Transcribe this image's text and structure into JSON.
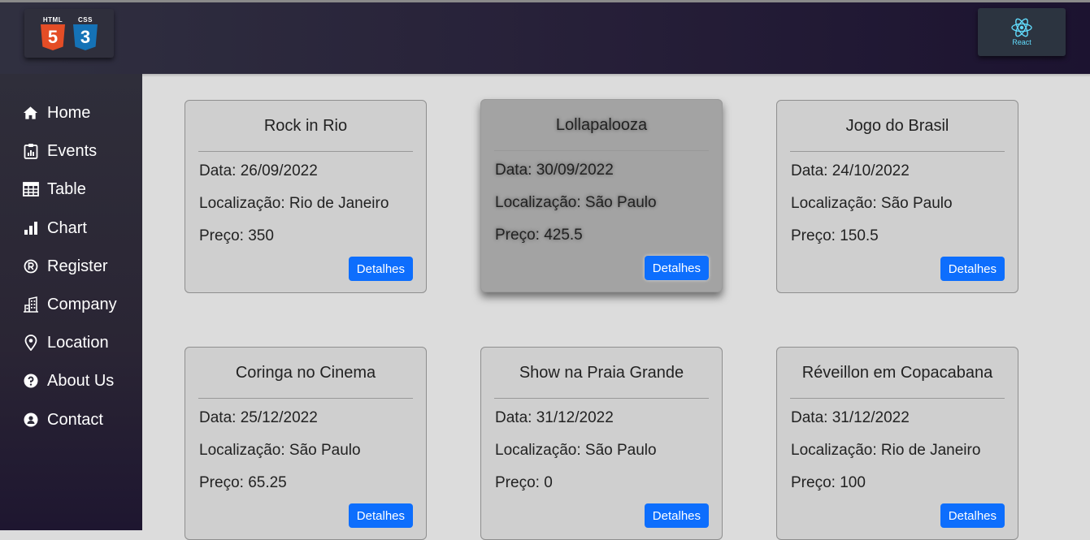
{
  "header": {
    "logo_left": {
      "html_label": "HTML",
      "html_char": "5",
      "css_label": "CSS",
      "css_char": "3"
    },
    "logo_right": {
      "label": "React",
      "icon": "react-atom-icon"
    }
  },
  "sidebar": {
    "items": [
      {
        "label": "Home",
        "icon": "home-icon"
      },
      {
        "label": "Events",
        "icon": "clipboard-icon"
      },
      {
        "label": "Table",
        "icon": "table-icon"
      },
      {
        "label": "Chart",
        "icon": "bar-chart-icon"
      },
      {
        "label": "Register",
        "icon": "registered-icon"
      },
      {
        "label": "Company",
        "icon": "building-icon"
      },
      {
        "label": "Location",
        "icon": "map-pin-icon"
      },
      {
        "label": "About Us",
        "icon": "question-icon"
      },
      {
        "label": "Contact",
        "icon": "contact-icon"
      }
    ]
  },
  "events": [
    {
      "title": "Rock in Rio",
      "date": "Data: 26/09/2022",
      "location": "Localização: Rio de Janeiro",
      "price": "Preço: 350",
      "button": "Detalhes"
    },
    {
      "title": "Lollapalooza",
      "date": "Data: 30/09/2022",
      "location": "Localização: São Paulo",
      "price": "Preço: 425.5",
      "button": "Detalhes"
    },
    {
      "title": "Jogo do Brasil",
      "date": "Data: 24/10/2022",
      "location": "Localização: São Paulo",
      "price": "Preço: 150.5",
      "button": "Detalhes"
    },
    {
      "title": "Coringa no Cinema",
      "date": "Data: 25/12/2022",
      "location": "Localização: São Paulo",
      "price": "Preço: 65.25",
      "button": "Detalhes"
    },
    {
      "title": "Show na Praia Grande",
      "date": "Data: 31/12/2022",
      "location": "Localização: São Paulo",
      "price": "Preço: 0",
      "button": "Detalhes"
    },
    {
      "title": "Réveillon em Copacabana",
      "date": "Data: 31/12/2022",
      "location": "Localização: Rio de Janeiro",
      "price": "Preço: 100",
      "button": "Detalhes"
    }
  ],
  "colors": {
    "button": "#0d6efd",
    "card": "#cfcfcf",
    "card_hover": "#a3a3a3",
    "content_bg": "#dcdcdc",
    "sidebar_bg": "#2f2e3a"
  }
}
